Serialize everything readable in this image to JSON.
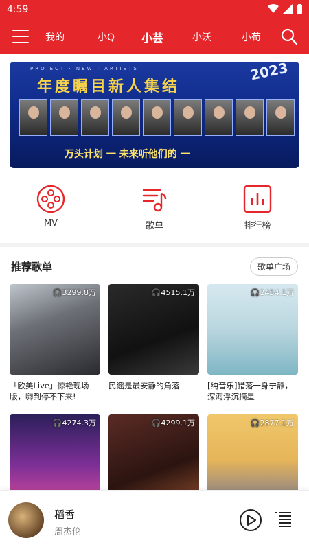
{
  "status": {
    "time": "4:59"
  },
  "nav": {
    "tabs": [
      {
        "label": "我的"
      },
      {
        "label": "小Q"
      },
      {
        "label": "小芸"
      },
      {
        "label": "小沃"
      },
      {
        "label": "小荀"
      }
    ],
    "active_tab": "小芸"
  },
  "banner": {
    "top_text": "PROJECT · NEW · ARTISTS",
    "year": "2023",
    "title": "年度瞩目新人集结",
    "slogan": "万头计划 一 未来听他们的 一",
    "artists": [
      "",
      "",
      "",
      "",
      "",
      "",
      "",
      "",
      ""
    ]
  },
  "shortcuts": [
    {
      "label": "MV",
      "icon": "film-reel-icon"
    },
    {
      "label": "歌单",
      "icon": "playlist-music-icon"
    },
    {
      "label": "排行榜",
      "icon": "chart-bars-icon"
    }
  ],
  "section": {
    "title": "推荐歌单",
    "more_label": "歌单广场"
  },
  "playlists": [
    {
      "title": "「欧美Live」惊艳现场版，嗨到停不下来!",
      "plays": "3299.8万"
    },
    {
      "title": "民谣是最安静的角落",
      "plays": "4515.1万"
    },
    {
      "title": "[纯音乐]错落一身宁静，深海浮沉摘星",
      "plays": "2454.1万"
    },
    {
      "title": "",
      "plays": "4274.3万"
    },
    {
      "title": "",
      "plays": "4299.1万"
    },
    {
      "title": "",
      "plays": "2877.1万"
    }
  ],
  "player": {
    "song": "稻香",
    "artist": "周杰伦"
  },
  "colors": {
    "brand": "#e5262a"
  }
}
